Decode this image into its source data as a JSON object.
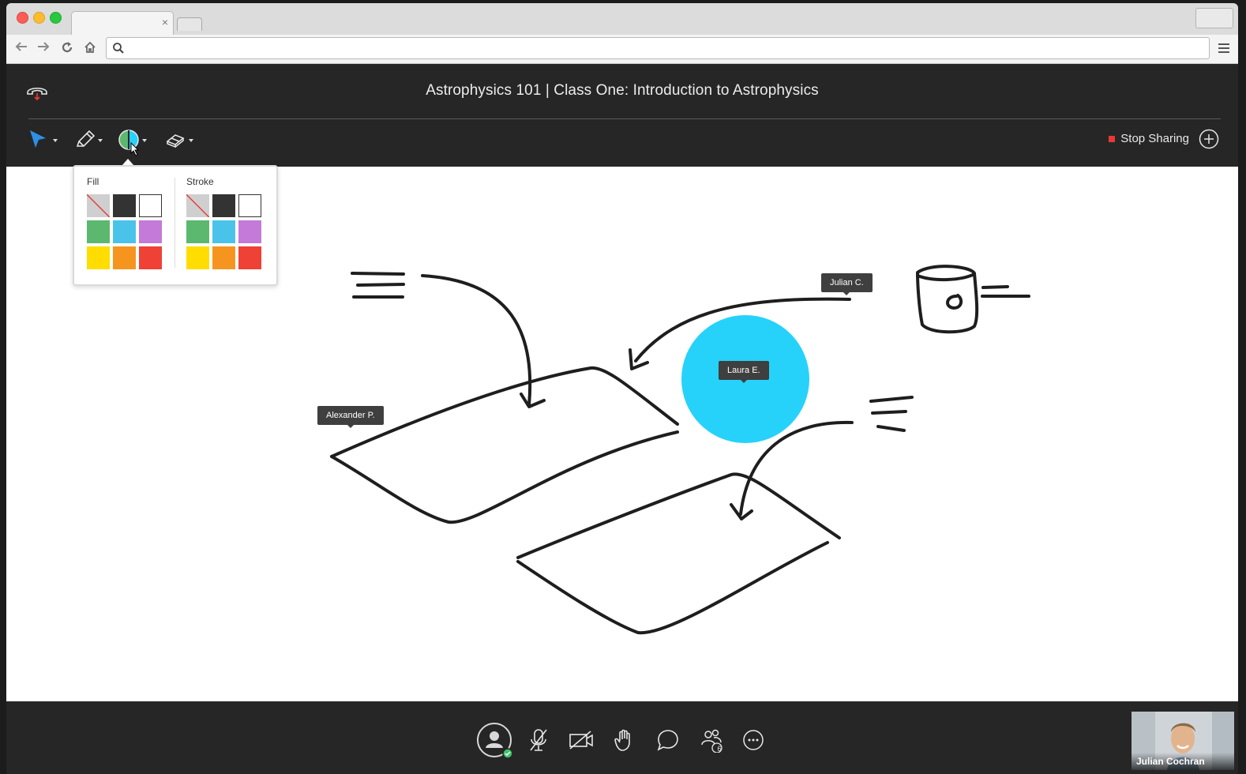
{
  "browser": {
    "tab_close": "×",
    "nav": {
      "back": "back-icon",
      "forward": "forward-icon",
      "reload": "reload-icon",
      "home": "home-icon"
    },
    "address_value": ""
  },
  "session": {
    "title": "Astrophysics 101 | Class One: Introduction to Astrophysics",
    "stop_sharing_label": "Stop Sharing"
  },
  "toolbar": {
    "tools": [
      "select-tool",
      "pencil-tool",
      "color-tool",
      "eraser-tool"
    ]
  },
  "color_palette": {
    "fill_label": "Fill",
    "stroke_label": "Stroke",
    "colors": [
      "none",
      "#333333",
      "#ffffff",
      "#5cb86e",
      "#4ac3ea",
      "#c47ad8",
      "#ffdd00",
      "#f5951f",
      "#ef4136"
    ]
  },
  "canvas": {
    "circle_color": "#26d2fa",
    "cursor_labels": {
      "alexander": "Alexander P.",
      "julian": "Julian C.",
      "laura": "Laura E."
    }
  },
  "controls": {
    "participants_count": "6"
  },
  "self_video": {
    "name": "Julian Cochran"
  }
}
